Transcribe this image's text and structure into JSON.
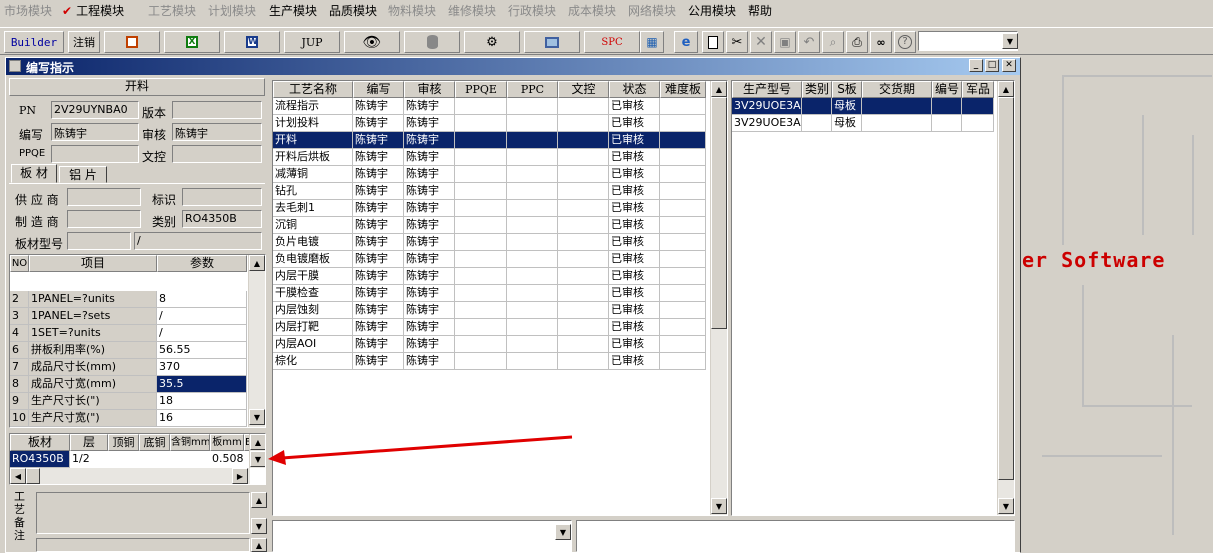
{
  "menu": {
    "items": [
      {
        "label": "市场模块",
        "enabled": false
      },
      {
        "label": "工程模块",
        "enabled": true,
        "checked": true
      },
      {
        "label": "工艺模块",
        "enabled": false
      },
      {
        "label": "计划模块",
        "enabled": false
      },
      {
        "label": "生产模块",
        "enabled": true
      },
      {
        "label": "品质模块",
        "enabled": true
      },
      {
        "label": "物料模块",
        "enabled": false
      },
      {
        "label": "维修模块",
        "enabled": false
      },
      {
        "label": "行政模块",
        "enabled": false
      },
      {
        "label": "成本模块",
        "enabled": false
      },
      {
        "label": "网络模块",
        "enabled": false
      },
      {
        "label": "公用模块",
        "enabled": true
      },
      {
        "label": "帮助",
        "enabled": true
      }
    ]
  },
  "toolbar": {
    "builder": "Builder",
    "logout": "注销",
    "jup": "JUP",
    "spc": "SPC"
  },
  "window": {
    "title": "编写指示"
  },
  "form": {
    "section_title": "开料",
    "pn_label": "PN",
    "pn_value": "2V29UYNBA0",
    "version_label": "版本",
    "version_value": "",
    "author_label": "编写",
    "author_value": "陈铸宇",
    "reviewer_label": "审核",
    "reviewer_value": "陈铸宇",
    "ppqe_label": "PPQE",
    "ppqe_value": "",
    "doc_control_label": "文控",
    "doc_control_value": "",
    "tabs": [
      "板 材",
      "铝 片"
    ],
    "supplier_label": "供 应 商",
    "supplier_value": "",
    "mark_label": "标识",
    "mark_value": "",
    "manufacturer_label": "制 造 商",
    "manufacturer_value": "",
    "category_label": "类别",
    "category_value": "RO4350B",
    "board_model_label": "板材型号",
    "board_model_value": "",
    "board_model_value2": "/"
  },
  "param_table": {
    "headers": [
      "NO",
      "项目",
      "参数"
    ],
    "rows": [
      [
        "2",
        "1PANEL=?units",
        "8"
      ],
      [
        "3",
        "1PANEL=?sets",
        "/"
      ],
      [
        "4",
        "1SET=?units",
        "/"
      ],
      [
        "6",
        "拼板利用率(%)",
        "56.55"
      ],
      [
        "7",
        "成品尺寸长(mm)",
        "370"
      ],
      [
        "8",
        "成品尺寸宽(mm)",
        "35.5"
      ],
      [
        "9",
        "生产尺寸长(\")",
        "18"
      ],
      [
        "10",
        "生产尺寸宽(\")",
        "16"
      ]
    ],
    "selected_row": 5
  },
  "material_table": {
    "headers": [
      "板材",
      "层",
      "顶铜",
      "底铜",
      "含铜mm",
      "板mm",
      "E"
    ],
    "row": [
      "RO4350B",
      "1/2",
      "",
      "",
      "",
      "0.508"
    ]
  },
  "notes": {
    "label": "工艺备注"
  },
  "process_table": {
    "headers": [
      "工艺名称",
      "编写",
      "审核",
      "PPQE",
      "PPC",
      "文控",
      "状态",
      "难度板"
    ],
    "rows": [
      [
        "流程指示",
        "陈铸宇",
        "陈铸宇",
        "",
        "",
        "",
        "已审核",
        ""
      ],
      [
        "计划投料",
        "陈铸宇",
        "陈铸宇",
        "",
        "",
        "",
        "已审核",
        ""
      ],
      [
        "开料",
        "陈铸宇",
        "陈铸宇",
        "",
        "",
        "",
        "已审核",
        ""
      ],
      [
        "开料后烘板",
        "陈铸宇",
        "陈铸宇",
        "",
        "",
        "",
        "已审核",
        ""
      ],
      [
        "减薄铜",
        "陈铸宇",
        "陈铸宇",
        "",
        "",
        "",
        "已审核",
        ""
      ],
      [
        "钻孔",
        "陈铸宇",
        "陈铸宇",
        "",
        "",
        "",
        "已审核",
        ""
      ],
      [
        "去毛刺1",
        "陈铸宇",
        "陈铸宇",
        "",
        "",
        "",
        "已审核",
        ""
      ],
      [
        "沉铜",
        "陈铸宇",
        "陈铸宇",
        "",
        "",
        "",
        "已审核",
        ""
      ],
      [
        "负片电镀",
        "陈铸宇",
        "陈铸宇",
        "",
        "",
        "",
        "已审核",
        ""
      ],
      [
        "负电镀磨板",
        "陈铸宇",
        "陈铸宇",
        "",
        "",
        "",
        "已审核",
        ""
      ],
      [
        "内层干膜",
        "陈铸宇",
        "陈铸宇",
        "",
        "",
        "",
        "已审核",
        ""
      ],
      [
        "干膜检查",
        "陈铸宇",
        "陈铸宇",
        "",
        "",
        "",
        "已审核",
        ""
      ],
      [
        "内层蚀刻",
        "陈铸宇",
        "陈铸宇",
        "",
        "",
        "",
        "已审核",
        ""
      ],
      [
        "内层打靶",
        "陈铸宇",
        "陈铸宇",
        "",
        "",
        "",
        "已审核",
        ""
      ],
      [
        "内层AOI",
        "陈铸宇",
        "陈铸宇",
        "",
        "",
        "",
        "已审核",
        ""
      ],
      [
        "棕化",
        "陈铸宇",
        "陈铸宇",
        "",
        "",
        "",
        "已审核",
        ""
      ]
    ],
    "selected_row": 2
  },
  "product_table": {
    "headers": [
      "生产型号",
      "类别",
      "S板",
      "交货期",
      "编号",
      "军品"
    ],
    "rows": [
      [
        "3V29UOE3A0",
        "",
        "母板",
        "",
        "",
        ""
      ],
      [
        "3V29UOE3A0",
        "",
        "母板",
        "",
        "",
        ""
      ]
    ],
    "selected_row": 0
  },
  "background": {
    "brand_text": "er Software"
  },
  "colors": {
    "selection": "#0a246a",
    "annotation_arrow": "#e00000",
    "brand_text": "#cc0000"
  }
}
